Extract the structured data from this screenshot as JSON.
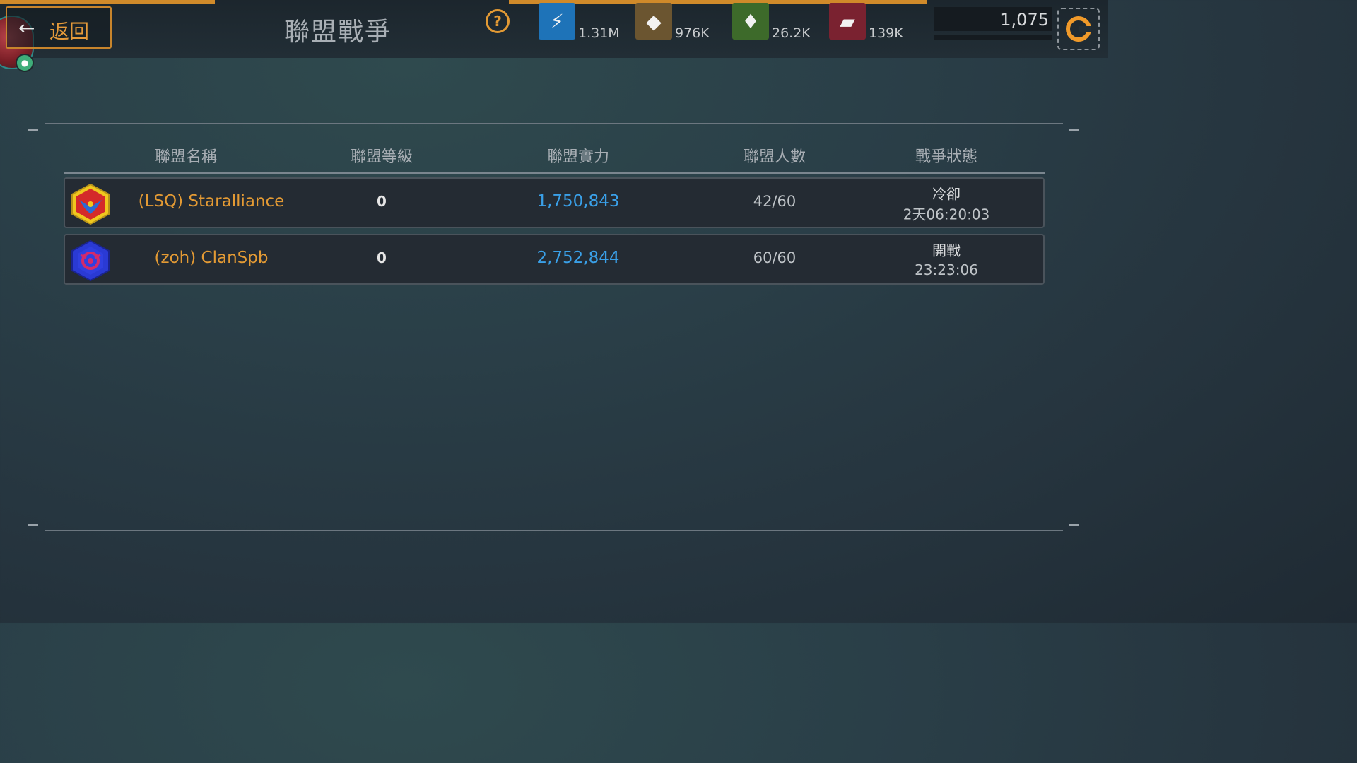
{
  "header": {
    "back_label": "返回",
    "back_arrow": "←",
    "title": "聯盟戰爭",
    "help_icon": "?"
  },
  "resources": [
    {
      "name": "energy-icon",
      "value": "1.31M",
      "color": "#1e73b8"
    },
    {
      "name": "ore-icon",
      "value": "976K",
      "color": "#6b5530"
    },
    {
      "name": "crystal-icon",
      "value": "26.2K",
      "color": "#3d6a2a"
    },
    {
      "name": "alloy-icon",
      "value": "139K",
      "color": "#7a2230"
    }
  ],
  "currency": {
    "value": "1,075",
    "icon": "shop-g-icon",
    "accent": "#f09a2a"
  },
  "table": {
    "headers": [
      "聯盟名稱",
      "聯盟等級",
      "聯盟實力",
      "聯盟人數",
      "戰爭狀態"
    ],
    "rows": [
      {
        "emblem": "red-eagle-emblem-icon",
        "name": "(LSQ) Staralliance",
        "level": "0",
        "power": "1,750,843",
        "members": "42/60",
        "status": "冷卻",
        "time": "2天06:20:03"
      },
      {
        "emblem": "blue-spiral-emblem-icon",
        "name": "(zoh) ClanSpb",
        "level": "0",
        "power": "2,752,844",
        "members": "60/60",
        "status": "開戰",
        "time": "23:23:06"
      }
    ]
  },
  "colors": {
    "accent": "#e39a34",
    "power": "#3aa0e8"
  }
}
